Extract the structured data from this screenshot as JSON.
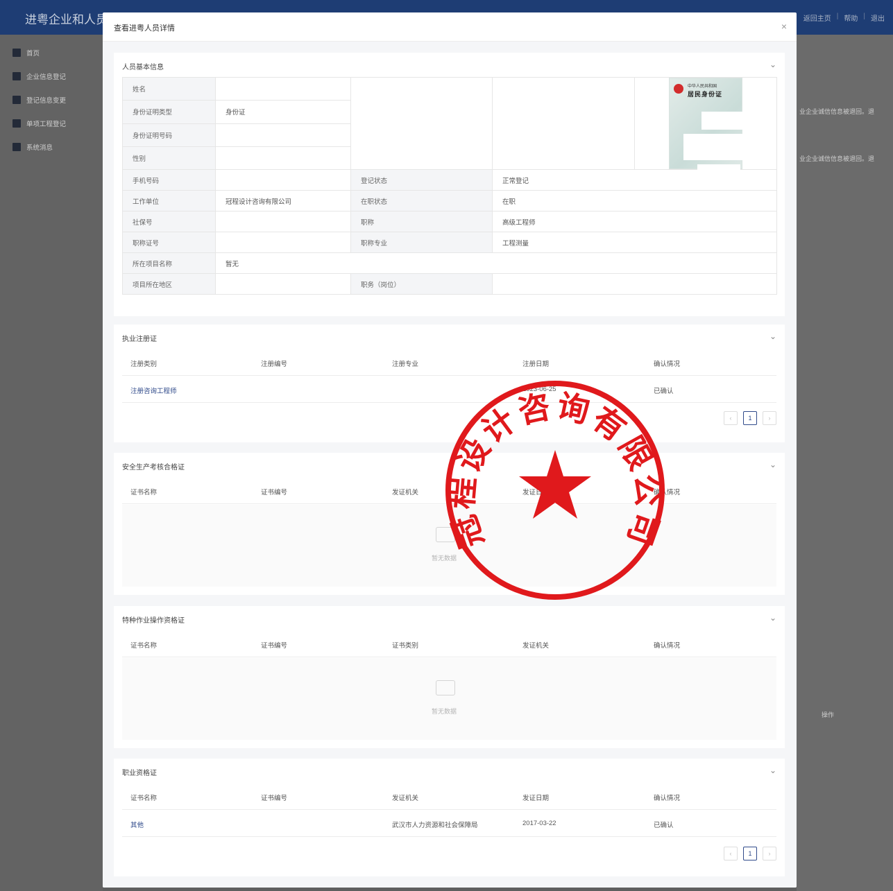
{
  "app": {
    "title": "进粤企业和人员诚",
    "links": [
      "返回主页",
      "帮助",
      "退出"
    ]
  },
  "sidebar": {
    "items": [
      {
        "label": "首页",
        "icon": "home-icon"
      },
      {
        "label": "企业信息登记",
        "icon": "building-icon"
      },
      {
        "label": "登记信息变更",
        "icon": "edit-icon"
      },
      {
        "label": "单项工程登记",
        "icon": "clipboard-icon"
      },
      {
        "label": "系统消息",
        "icon": "message-icon"
      }
    ]
  },
  "background": {
    "row_text_1": "业企业诚信信息被退回。退",
    "row_text_2": "业企业诚信信息被退回。退",
    "op_label": "操作"
  },
  "modal": {
    "title": "查看进粤人员详情",
    "close": "×"
  },
  "basic": {
    "title": "人员基本信息",
    "labels": {
      "name": "姓名",
      "id_type": "身份证明类型",
      "id_no": "身份证明号码",
      "gender": "性别",
      "phone": "手机号码",
      "reg_status": "登记状态",
      "employer": "工作单位",
      "job_status": "在职状态",
      "social_no": "社保号",
      "title": "职称",
      "title_cert": "职称证号",
      "title_major": "职称专业",
      "project_name": "所在项目名称",
      "project_region": "项目所在地区",
      "position": "职务（岗位）"
    },
    "values": {
      "id_type": "身份证",
      "reg_status": "正常登记",
      "employer": "冠程设计咨询有限公司",
      "job_status": "在职",
      "title": "高级工程师",
      "title_major": "工程测量",
      "project_name": "暂无"
    },
    "id_card": {
      "line1": "中华人民共和国",
      "line2": "居民身份证"
    }
  },
  "practice": {
    "title": "执业注册证",
    "headers": [
      "注册类别",
      "注册编号",
      "注册专业",
      "注册日期",
      "确认情况"
    ],
    "rows": [
      {
        "type": "注册咨询工程师",
        "date": "2023-06-25",
        "status": "已确认"
      }
    ],
    "page": "1"
  },
  "safety": {
    "title": "安全生产考核合格证",
    "headers": [
      "证书名称",
      "证书编号",
      "发证机关",
      "发证日期",
      "确认情况"
    ],
    "empty": "暂无数据"
  },
  "special": {
    "title": "特种作业操作资格证",
    "headers": [
      "证书名称",
      "证书编号",
      "证书类别",
      "发证机关",
      "确认情况"
    ],
    "empty": "暂无数据"
  },
  "qualification": {
    "title": "职业资格证",
    "headers": [
      "证书名称",
      "证书编号",
      "发证机关",
      "发证日期",
      "确认情况"
    ],
    "rows": [
      {
        "name": "其他",
        "authority": "武汉市人力资源和社会保障局",
        "date": "2017-03-22",
        "status": "已确认"
      }
    ],
    "page": "1"
  },
  "seal": {
    "text": "冠程设计咨询有限公司",
    "color": "#e0191c"
  },
  "colors": {
    "header": "#1e3d74",
    "link": "#2f4a8a",
    "seal": "#e0191c"
  }
}
